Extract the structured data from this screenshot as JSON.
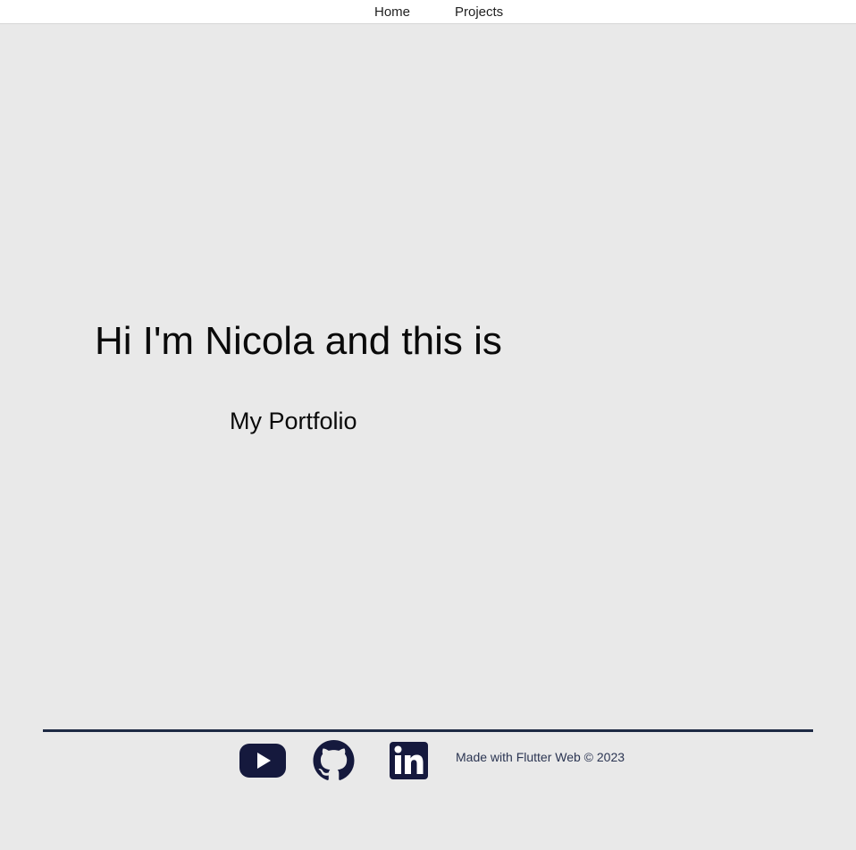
{
  "nav": {
    "home_label": "Home",
    "projects_label": "Projects"
  },
  "hero": {
    "title": "Hi I'm Nicola and this is",
    "subtitle": "My Portfolio"
  },
  "footer": {
    "social_icons": [
      "youtube-icon",
      "github-icon",
      "linkedin-icon"
    ],
    "credit": "Made with Flutter Web © 2023"
  },
  "colors": {
    "background": "#e9e9e9",
    "navbar": "#ffffff",
    "icon_navy": "#15193d",
    "divider": "#1e2a44",
    "text": "#0a0a0a"
  }
}
